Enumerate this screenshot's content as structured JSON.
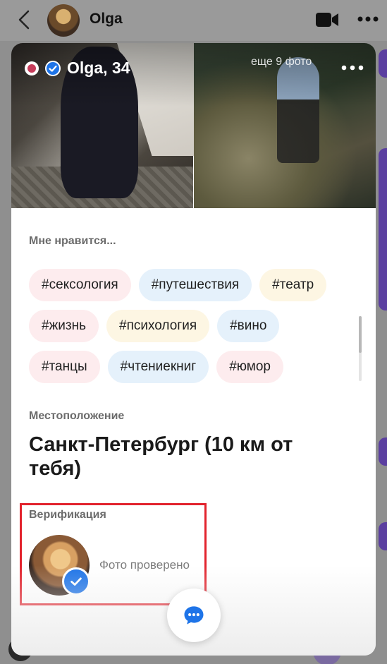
{
  "chat_header": {
    "name": "Olga"
  },
  "profile": {
    "title": "Olga, 34",
    "more_photos": "еще 9 фото"
  },
  "interests": {
    "label": "Мне нравится...",
    "rows": [
      [
        {
          "text": "#сексология",
          "color": "pink"
        },
        {
          "text": "#путешествия",
          "color": "blue"
        },
        {
          "text": "#театр",
          "color": "yellow"
        }
      ],
      [
        {
          "text": "#жизнь",
          "color": "pink"
        },
        {
          "text": "#психология",
          "color": "yellow"
        },
        {
          "text": "#вино",
          "color": "blue"
        }
      ],
      [
        {
          "text": "#танцы",
          "color": "pink"
        },
        {
          "text": "#чтениекниг",
          "color": "blue"
        },
        {
          "text": "#юмор",
          "color": "pink"
        }
      ]
    ]
  },
  "location": {
    "label": "Местоположение",
    "value": "Санкт-Петербург (10 км от тебя)"
  },
  "verification": {
    "label": "Верификация",
    "status": "Фото проверено"
  },
  "colors": {
    "accent": "#1e74e8",
    "highlight_border": "#e2232d",
    "tag_pink": "#fdecee",
    "tag_blue": "#e5f1fb",
    "tag_yellow": "#fdf6e3"
  },
  "icons": {
    "back": "chevron-left-icon",
    "video": "video-camera-icon",
    "more": "more-horizontal-icon",
    "verified": "check-badge-icon",
    "chat": "chat-bubble-icon"
  }
}
